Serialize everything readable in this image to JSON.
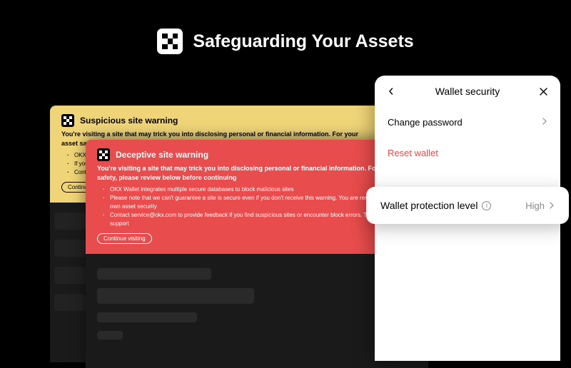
{
  "hero": {
    "title": "Safeguarding Your Assets"
  },
  "suspicious": {
    "title": "Suspicious site warning",
    "body": "You're visiting a site that may trick you into disclosing personal or financial information. For your asset safety, please review below",
    "bullets": [
      "OKX Wallet integrates multiple secure databases to block malicious sites",
      "If you don't receive this warning we can't guarantee a site is secure",
      "Contact service to provide feedback on suspicious sites"
    ],
    "continue": "Continue visiting"
  },
  "deceptive": {
    "title": "Deceptive site warning",
    "body": "You're visiting a site that may trick you into disclosing personal or financial information. For your asset safety, please review below before continuing",
    "bullets": [
      "OKX Wallet integrates multiple secure databases to block malicious sites",
      "Please note that we can't guarantee a site is secure even if you don't receive this warning. You are responsible for your own asset security",
      "Contact service@okx.com to provide feedback if you find suspicious sites or encounter block errors. Thanks for your support"
    ],
    "continue": "Continue visiting"
  },
  "settings": {
    "title": "Wallet security",
    "change_password": "Change password",
    "reset_wallet": "Reset wallet",
    "protection_label": "Wallet protection level",
    "protection_value": "High"
  }
}
